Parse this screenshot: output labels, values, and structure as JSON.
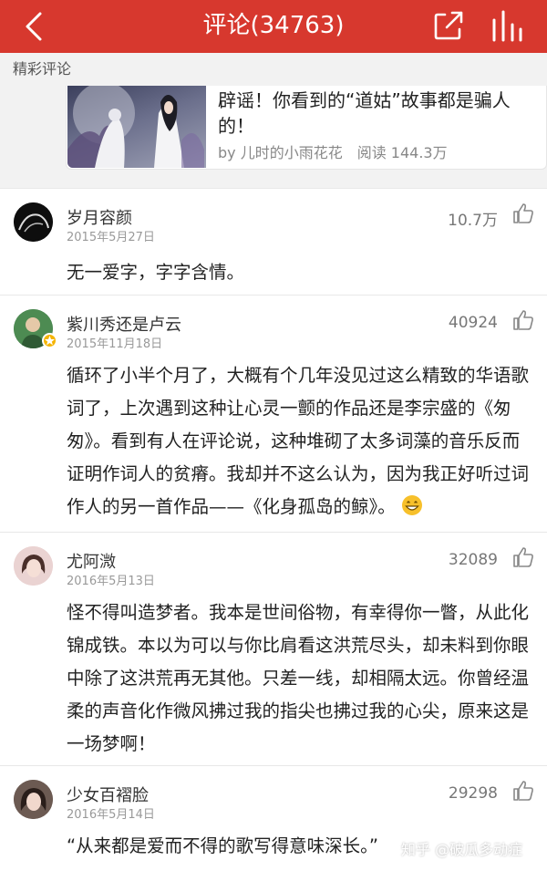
{
  "header": {
    "title": "评论(34763)",
    "icons": [
      "back-icon",
      "share-icon",
      "stats-icon"
    ],
    "bg_color": "#d7382e"
  },
  "section": {
    "label": "精彩评论"
  },
  "article": {
    "title": "辟谣！你看到的“道姑”故事都是骗人的！",
    "author": "by 儿时的小雨花花",
    "reads": "阅读 144.3万"
  },
  "comments": [
    {
      "user": "岁月容颜",
      "date": "2015年5月27日",
      "likes": "10.7万",
      "text": "无一爱字，字字含情。"
    },
    {
      "user": "紫川秀还是卢云",
      "date": "2015年11月18日",
      "likes": "40924",
      "text": "循环了小半个月了，大概有个几年没见过这么精致的华语歌词了，上次遇到这种让心灵一颤的作品还是李宗盛的《匆匆》。看到有人在评论说，这种堆砌了太多词藻的音乐反而证明作词人的贫瘠。我却并不这么认为，因为我正好听过词作人的另一首作品——《化身孤岛的鲸》。"
    },
    {
      "user": "尤阿溦",
      "date": "2016年5月13日",
      "likes": "32089",
      "text": "怪不得叫造梦者。我本是世间俗物，有幸得你一瞥，从此化锦成铁。本以为可以与你比肩看这洪荒尽头，却未料到你眼中除了这洪荒再无其他。只差一线，却相隔太远。你曾经温柔的声音化作微风拂过我的指尖也拂过我的心尖，原来这是一场梦啊！"
    },
    {
      "user": "少女百褶脸",
      "date": "2016年5月14日",
      "likes": "29298",
      "text": "“从来都是爱而不得的歌写得意味深长。”"
    }
  ],
  "watermark": "知乎 @破瓜多动症"
}
